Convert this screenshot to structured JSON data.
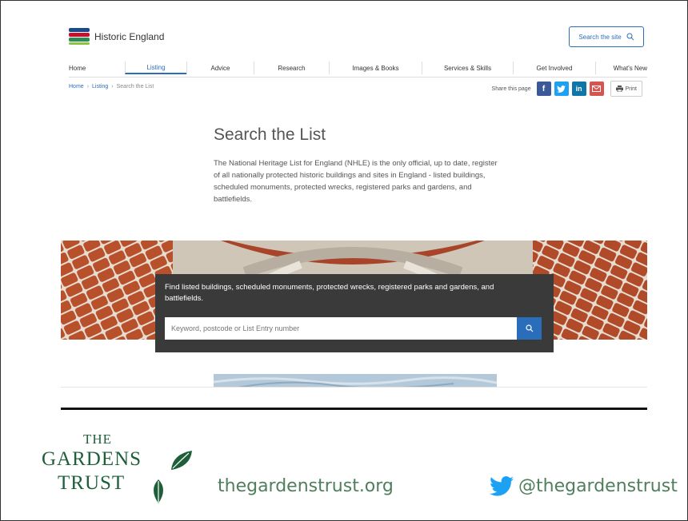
{
  "site": {
    "brand": "Historic England",
    "search_button_label": "Search the site",
    "nav": [
      "Home",
      "Listing",
      "Advice",
      "Research",
      "Images & Books",
      "Services & Skills",
      "Get Involved",
      "What's New"
    ],
    "active_nav": "Listing",
    "breadcrumb": [
      "Home",
      "Listing",
      "Search the List"
    ],
    "share_label": "Share this page",
    "share_buttons": [
      {
        "name": "facebook",
        "glyph": "f",
        "color": "#3b5998"
      },
      {
        "name": "twitter",
        "glyph": "t",
        "color": "#1da1f2"
      },
      {
        "name": "linkedin",
        "glyph": "in",
        "color": "#0e76a8"
      },
      {
        "name": "email",
        "glyph": "✉",
        "color": "#d9534f"
      }
    ],
    "print_label": "Print",
    "page_title": "Search the List",
    "intro": "The National Heritage List for England (NHLE) is the only official, up to date, register of all nationally protected historic buildings and sites in England - listed buildings, scheduled monuments, protected wrecks, registered parks and gardens, and battlefields.",
    "search_panel_text": "Find listed buildings, scheduled monuments, protected wrecks, registered parks and gardens, and battlefields.",
    "search_placeholder": "Keyword, postcode or List Entry number",
    "accent_color": "#2a6ebb"
  },
  "footer": {
    "logo_lines": [
      "THE",
      "GARDENS",
      "TRUST"
    ],
    "website": "thegardenstrust.org",
    "twitter_handle": "@thegardenstrust",
    "brand_color": "#1e5f3a"
  }
}
